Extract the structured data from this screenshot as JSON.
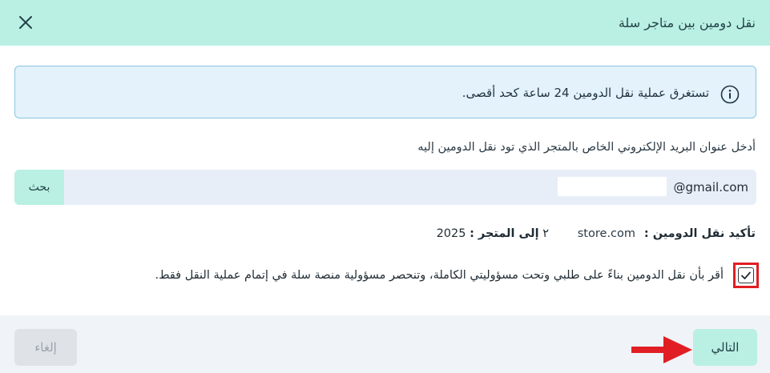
{
  "header": {
    "title": "نقل دومين بين متاجر سلة",
    "close_icon": "close-icon"
  },
  "alert": {
    "icon": "info-icon",
    "text": "تستغرق عملية نقل الدومين 24 ساعة كحد أقصى."
  },
  "email": {
    "label": "أدخل عنوان البريد الإلكتروني الخاص بالمتجر الذي تود نقل الدومين إليه",
    "value": "@gmail.com",
    "search_label": "بحث"
  },
  "confirm": {
    "label": "تأكيد نقل الدومين :",
    "from_store": "store.com",
    "to_label": "إلى المتجر :",
    "to_prefix": "٢",
    "to_store": "2025"
  },
  "agreement": {
    "checked": true,
    "text": "أقر بأن نقل الدومين بناءً على طلبي وتحت مسؤوليتي الكاملة، وتنحصر مسؤولية منصة سلة في إتمام عملية النقل فقط."
  },
  "footer": {
    "next_label": "التالي",
    "cancel_label": "إلغاء"
  },
  "colors": {
    "header_bg": "#b9f0e3",
    "alert_bg": "#e3f2fb",
    "alert_border": "#8cc6e6",
    "highlight_red": "#e01e24"
  }
}
